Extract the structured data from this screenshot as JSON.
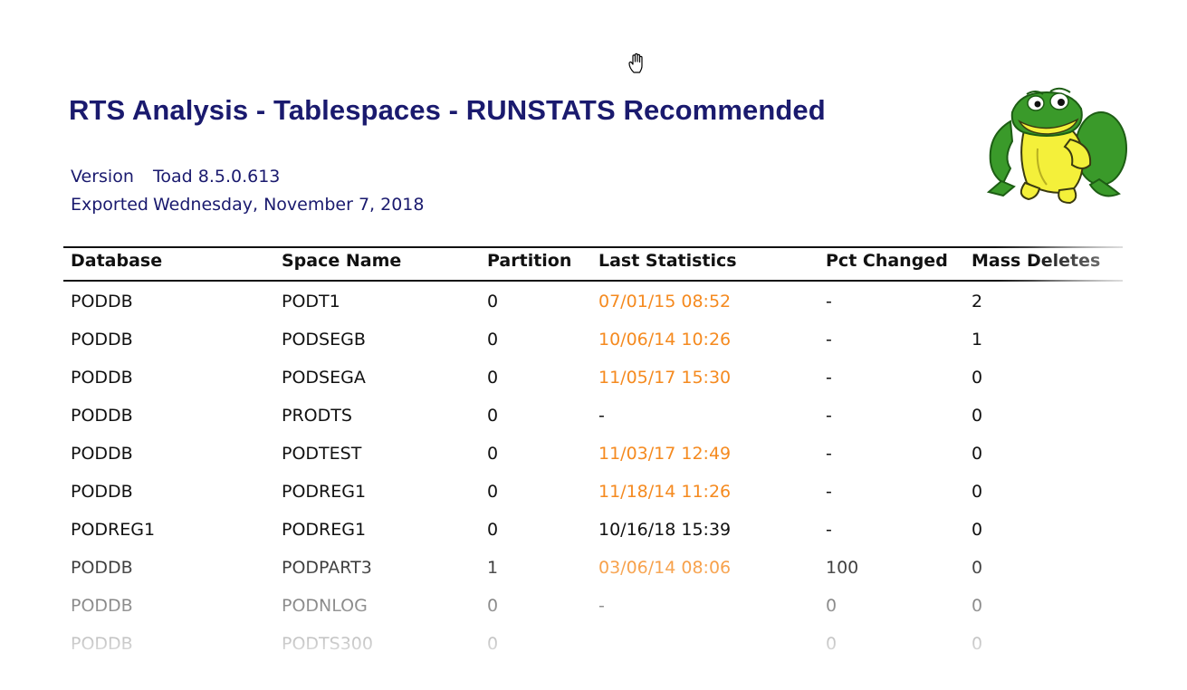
{
  "report": {
    "title": "RTS Analysis - Tablespaces - RUNSTATS Recommended",
    "version_label": "Version",
    "version_value": "Toad 8.5.0.613",
    "exported_label": "Exported",
    "exported_value": "Wednesday, November 7, 2018",
    "logo_icon": "toad-frog-logo-icon"
  },
  "cursor": {
    "icon": "hand-cursor-icon"
  },
  "colors": {
    "title": "#1a1a6e",
    "stale_date": "#f58a1f",
    "text": "#111111"
  },
  "table": {
    "columns": [
      "Database",
      "Space Name",
      "Partition",
      "Last Statistics",
      "Pct Changed",
      "Mass Deletes"
    ],
    "rows": [
      {
        "database": "PODDB",
        "space": "PODT1",
        "partition": "0",
        "last_stats": "07/01/15 08:52",
        "stale": true,
        "pct": "-",
        "mass": "2"
      },
      {
        "database": "PODDB",
        "space": "PODSEGB",
        "partition": "0",
        "last_stats": "10/06/14 10:26",
        "stale": true,
        "pct": "-",
        "mass": "1"
      },
      {
        "database": "PODDB",
        "space": "PODSEGA",
        "partition": "0",
        "last_stats": "11/05/17 15:30",
        "stale": true,
        "pct": "-",
        "mass": "0"
      },
      {
        "database": "PODDB",
        "space": "PRODTS",
        "partition": "0",
        "last_stats": "-",
        "stale": false,
        "pct": "-",
        "mass": "0"
      },
      {
        "database": "PODDB",
        "space": "PODTEST",
        "partition": "0",
        "last_stats": "11/03/17 12:49",
        "stale": true,
        "pct": "-",
        "mass": "0"
      },
      {
        "database": "PODDB",
        "space": "PODREG1",
        "partition": "0",
        "last_stats": "11/18/14 11:26",
        "stale": true,
        "pct": "-",
        "mass": "0"
      },
      {
        "database": "PODREG1",
        "space": "PODREG1",
        "partition": "0",
        "last_stats": "10/16/18 15:39",
        "stale": false,
        "pct": "-",
        "mass": "0"
      },
      {
        "database": "PODDB",
        "space": "PODPART3",
        "partition": "1",
        "last_stats": "03/06/14 08:06",
        "stale": true,
        "pct": "100",
        "mass": "0"
      },
      {
        "database": "PODDB",
        "space": "PODNLOG",
        "partition": "0",
        "last_stats": "-",
        "stale": false,
        "pct": "0",
        "mass": "0"
      },
      {
        "database": "PODDB",
        "space": "PODTS300",
        "partition": "0",
        "last_stats": "",
        "stale": false,
        "pct": "0",
        "mass": "0"
      }
    ]
  }
}
